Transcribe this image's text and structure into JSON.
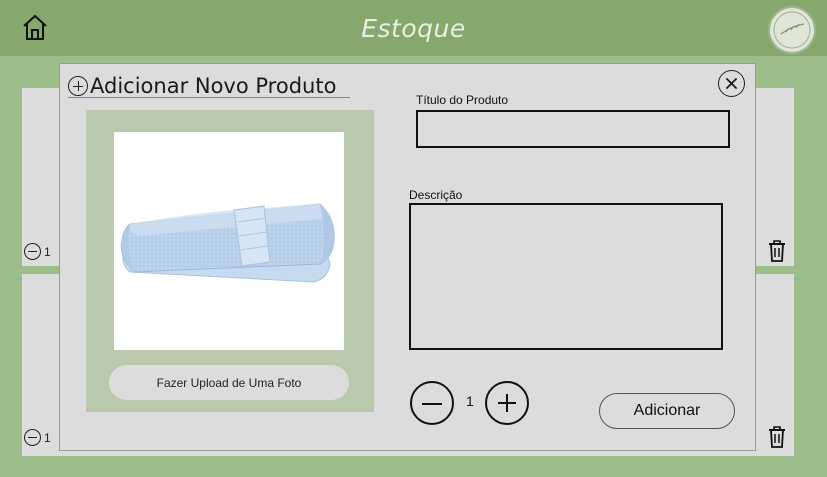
{
  "header": {
    "title": "Estoque",
    "home_icon": "home-icon",
    "logo_icon": "brand-logo",
    "colors": {
      "bar": "#86a86c",
      "background": "#9dbd8a",
      "title": "#e9efe4"
    }
  },
  "background_cards": [
    {
      "quantity": "1"
    },
    {
      "quantity": "1"
    }
  ],
  "modal": {
    "title": "Adicionar Novo Produto",
    "close_icon": "close-icon",
    "photo": {
      "image": "towel-photo",
      "upload_label": "Fazer Upload de Uma Foto"
    },
    "product_title": {
      "label": "Título do Produto",
      "value": ""
    },
    "description": {
      "label": "Descrição",
      "value": ""
    },
    "stepper": {
      "quantity": "1"
    },
    "submit_label": "Adicionar",
    "colors": {
      "panel": "#dcdcdc",
      "photo_panel": "#b8c9ad"
    }
  }
}
